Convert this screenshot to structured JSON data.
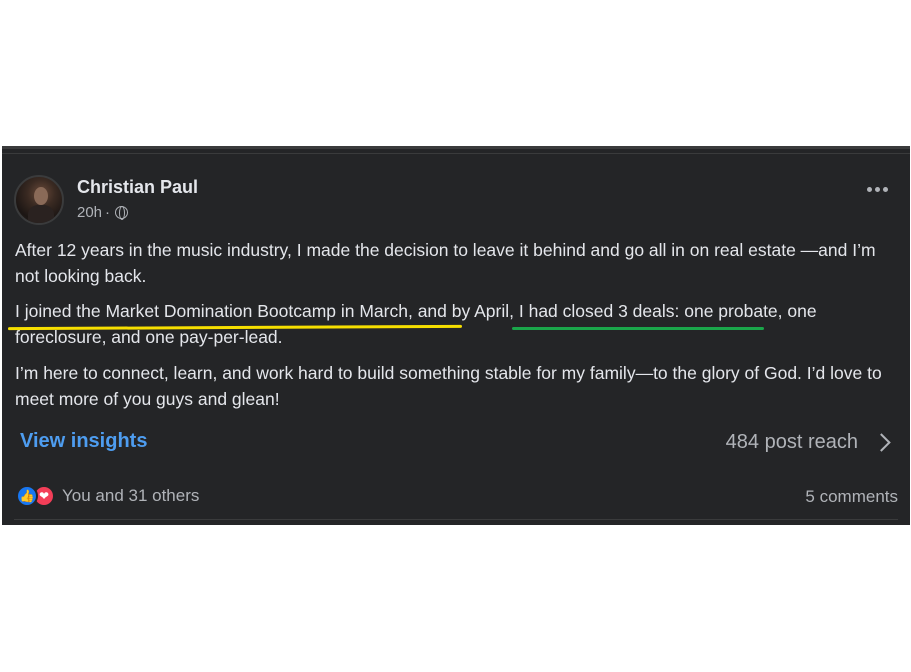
{
  "post": {
    "author": "Christian Paul",
    "time": "20h",
    "separator": "·",
    "paragraphs": {
      "p1": "After 12 years in the music industry, I made the decision to leave it behind and go all in on real estate —and I’m not looking back.",
      "p2": "I joined the Market Domination Bootcamp in March, and by April, I had closed 3 deals: one probate, one foreclosure, and one pay-per-lead.",
      "p3": "I’m here to connect, learn, and work hard to build something stable for my family—to the glory of God. I’d love to meet more of you guys and glean!"
    },
    "insights_label": "View insights",
    "reach_label": "484 post reach",
    "reactors": "You and 31 others",
    "comments": "5 comments"
  },
  "icons": [
    "globe-icon",
    "more-options-icon",
    "chevron-right-icon",
    "like-reaction-icon",
    "love-reaction-icon"
  ],
  "colors": {
    "card_bg": "#242527",
    "text": "#e4e6eb",
    "secondary_text": "#b0b3b8",
    "link": "#4e9df0",
    "highlight_yellow": "#f6df00",
    "highlight_green": "#1aa64a",
    "like": "#1877f2",
    "love": "#f33e58"
  }
}
